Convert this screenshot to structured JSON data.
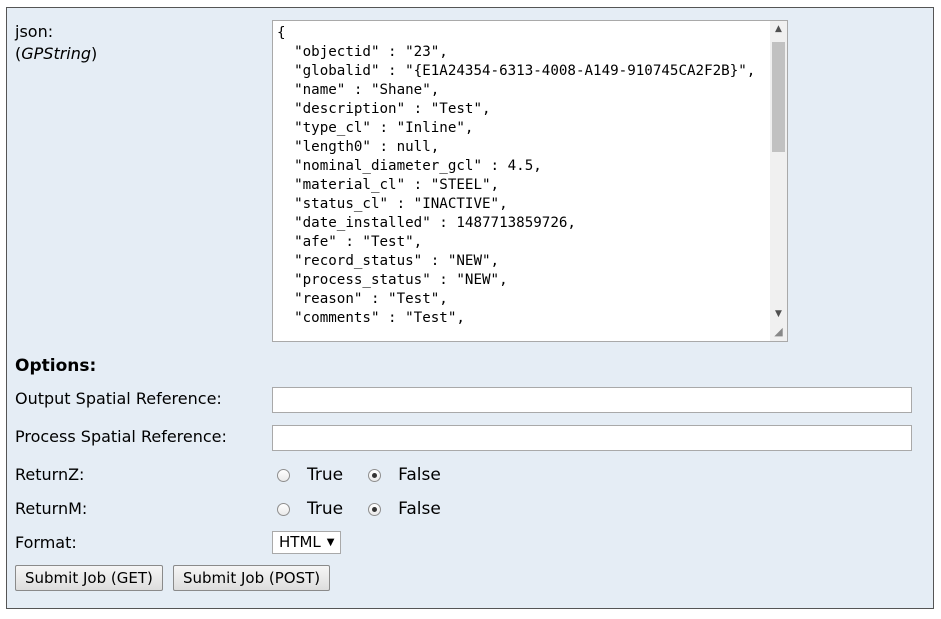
{
  "json_param": {
    "label": "json:",
    "type_open": "(",
    "type_name": "GPString",
    "type_close": ")",
    "value": "{\n  \"objectid\" : \"23\",\n  \"globalid\" : \"{E1A24354-6313-4008-A149-910745CA2F2B}\",\n  \"name\" : \"Shane\",\n  \"description\" : \"Test\",\n  \"type_cl\" : \"Inline\",\n  \"length0\" : null,\n  \"nominal_diameter_gcl\" : 4.5,\n  \"material_cl\" : \"STEEL\",\n  \"status_cl\" : \"INACTIVE\",\n  \"date_installed\" : 1487713859726,\n  \"afe\" : \"Test\",\n  \"record_status\" : \"NEW\",\n  \"process_status\" : \"NEW\",\n  \"reason\" : \"Test\",\n  \"comments\" : \"Test\","
  },
  "options": {
    "heading": "Options:",
    "output_sr_label": "Output Spatial Reference:",
    "output_sr_value": "",
    "process_sr_label": "Process Spatial Reference:",
    "process_sr_value": "",
    "return_z": {
      "label": "ReturnZ:",
      "true_label": "True",
      "false_label": "False",
      "selected": "False"
    },
    "return_m": {
      "label": "ReturnM:",
      "true_label": "True",
      "false_label": "False",
      "selected": "False"
    },
    "format": {
      "label": "Format:",
      "selected": "HTML"
    }
  },
  "buttons": {
    "submit_get": "Submit Job (GET)",
    "submit_post": "Submit Job (POST)"
  },
  "icons": {
    "scroll_up": "triangle-up-icon",
    "scroll_down": "triangle-down-icon",
    "resize": "resize-grip-icon",
    "select_caret": "caret-down-icon"
  }
}
